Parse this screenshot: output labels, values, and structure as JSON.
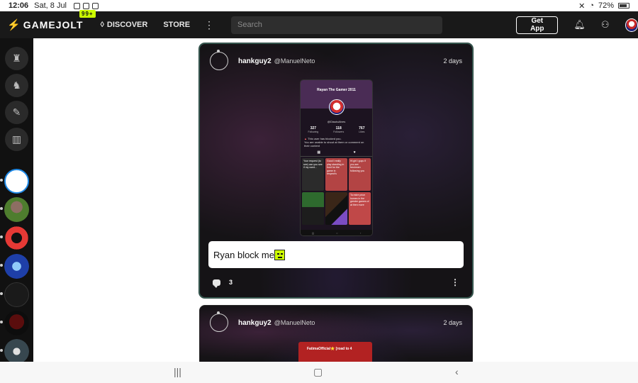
{
  "status": {
    "time": "12:06",
    "date": "Sat, 8 Jul",
    "battery": "72%"
  },
  "topnav": {
    "logo": "GAMEJOLT",
    "badge": "99+",
    "discover": "DISCOVER",
    "store": "STORE",
    "search_placeholder": "Search",
    "get_app": "Get App"
  },
  "posts": [
    {
      "user": "hankguy2",
      "handle": "@ManuelNeto",
      "time": "2 days",
      "caption": "Ryan block  me",
      "comments": "3",
      "embed": {
        "title": "Rayan The Gamer 2011",
        "handle": "@DiautoAlves",
        "stats": [
          {
            "value": "327",
            "label": "Following"
          },
          {
            "value": "118",
            "label": "Followers"
          },
          {
            "value": "767",
            "label": "Likes"
          }
        ],
        "warning_title": "This user has blocked you.",
        "warning_body": "You are unable to shout at them or comment on their content",
        "tiles": [
          "Your request (to see) can you see if my used...",
          "Good I really play standing in front for the game in respect's",
          "Hi girl i guys if you are freshmen following you",
          "",
          "",
          "Ta estre prioe homes in the grenter games of at then more"
        ]
      }
    },
    {
      "user": "hankguy2",
      "handle": "@ManuelNeto",
      "time": "2 days",
      "embed_title": "FatimaOfficial⭐ [road to 4"
    }
  ]
}
